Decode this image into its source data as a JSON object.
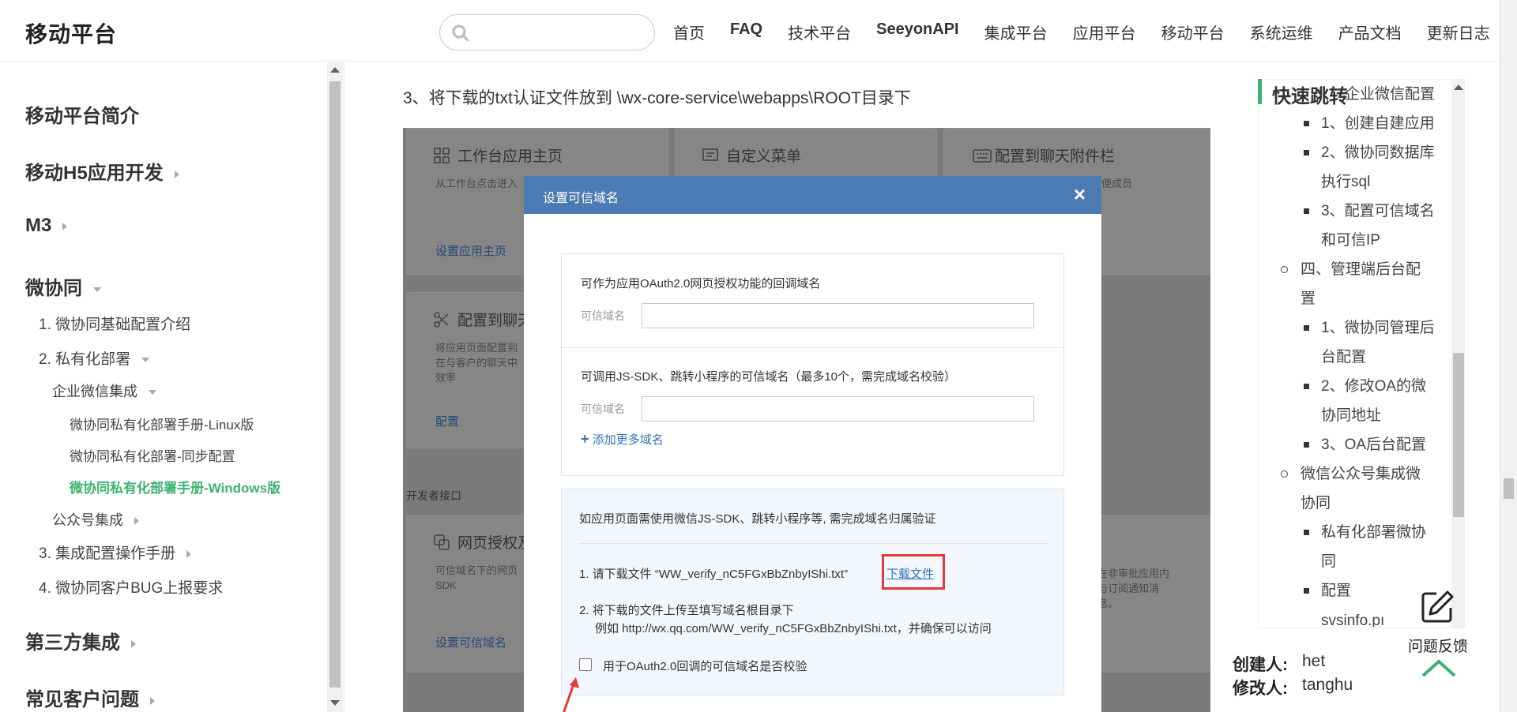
{
  "header": {
    "brand": "移动平台",
    "search_placeholder": "",
    "nav": [
      "首页",
      "FAQ",
      "技术平台",
      "SeeyonAPI",
      "集成平台",
      "应用平台",
      "移动平台",
      "系统运维",
      "产品文档",
      "更新日志"
    ]
  },
  "sidebar": {
    "items": [
      {
        "label": "移动平台简介"
      },
      {
        "label": "移动H5应用开发"
      },
      {
        "label": "M3"
      },
      {
        "label": "微协同"
      },
      {
        "label": "1. 微协同基础配置介绍"
      },
      {
        "label": "2. 私有化部署"
      },
      {
        "label": "企业微信集成"
      },
      {
        "label": "微协同私有化部署手册-Linux版"
      },
      {
        "label": "微协同私有化部署-同步配置"
      },
      {
        "label": "微协同私有化部署手册-Windows版"
      },
      {
        "label": "公众号集成"
      },
      {
        "label": "3. 集成配置操作手册"
      },
      {
        "label": "4. 微协同客户BUG上报要求"
      },
      {
        "label": "第三方集成"
      },
      {
        "label": "常见客户问题"
      }
    ]
  },
  "main": {
    "step_text": "3、将下载的txt认证文件放到 \\wx-core-service\\webapps\\ROOT目录下",
    "screenshot": {
      "cards": [
        {
          "title": "工作台应用主页",
          "desc": "从工作台点击进入",
          "link": "设置应用主页"
        },
        {
          "title": "自定义菜单",
          "desc": "",
          "link": ""
        },
        {
          "title": "配置到聊天附件栏",
          "desc": "栏，方便成员\n效率",
          "link": ""
        },
        {
          "title": "配置到聊天",
          "desc": "将应用页面配置到\n在与客户的聊天中\n效率",
          "link": "配置"
        },
        {
          "title": "网页授权及",
          "desc": "可信域名下的网页\nSDK",
          "link": "设置可信域名"
        },
        {
          "title": "",
          "desc": "在非审批应用内\n与订阅通知消\n息。",
          "link": ""
        }
      ],
      "dev_label": "开发者接口",
      "modal": {
        "title": "设置可信域名",
        "close": "×",
        "oauth_label": "可作为应用OAuth2.0网页授权功能的回调域名",
        "domain_label_1": "可信域名",
        "jssdk_label": "可调用JS-SDK、跳转小程序的可信域名（最多10个，需完成域名校验）",
        "domain_label_2": "可信域名",
        "add_more": "添加更多域名",
        "verify_intro": "如应用页面需使用微信JS-SDK、跳转小程序等, 需完成域名归属验证",
        "step1_prefix": "1. 请下载文件 “WW_verify_nC5FGxBbZnbyIShi.txt”",
        "step1_link": "下载文件",
        "step2": "2. 将下载的文件上传至填写域名根目录下",
        "step2_example": "例如 http://wx.qq.com/WW_verify_nC5FGxBbZnbyIShi.txt，并确保可以访问",
        "checkbox_label": "用于OAuth2.0回调的可信域名是否校验"
      }
    }
  },
  "toc": {
    "title": "快速跳转",
    "items": [
      {
        "label": "企业微信配置",
        "level": 2
      },
      {
        "label": "1、创建自建应用",
        "level": 3
      },
      {
        "label": "2、微协同数据库",
        "level": 3
      },
      {
        "label": "执行sql",
        "level": 3
      },
      {
        "label": "3、配置可信域名",
        "level": 3
      },
      {
        "label": "和可信IP",
        "level": 3
      },
      {
        "label": "四、管理端后台配",
        "level": 2
      },
      {
        "label": "置",
        "level": 2
      },
      {
        "label": "1、微协同管理后",
        "level": 3
      },
      {
        "label": "台配置",
        "level": 3
      },
      {
        "label": "2、修改OA的微",
        "level": 3
      },
      {
        "label": "协同地址",
        "level": 3
      },
      {
        "label": "3、OA后台配置",
        "level": 3
      },
      {
        "label": "微信公众号集成微",
        "level": 2
      },
      {
        "label": "协同",
        "level": 2
      },
      {
        "label": "私有化部署微协",
        "level": 3
      },
      {
        "label": "同",
        "level": 3
      },
      {
        "label": "配置",
        "level": 3
      },
      {
        "label": "svsinfo.pı",
        "level": 3
      }
    ]
  },
  "meta": {
    "creator_label": "创建人:",
    "creator": "het",
    "modifier_label": "修改人:",
    "modifier": "tanghu"
  },
  "feedback": {
    "label": "问题反馈"
  },
  "colors": {
    "accent_green": "#3cb371",
    "modal_header": "#4a7bb3",
    "link_blue": "#3571b7",
    "highlight_red": "#e53935"
  }
}
